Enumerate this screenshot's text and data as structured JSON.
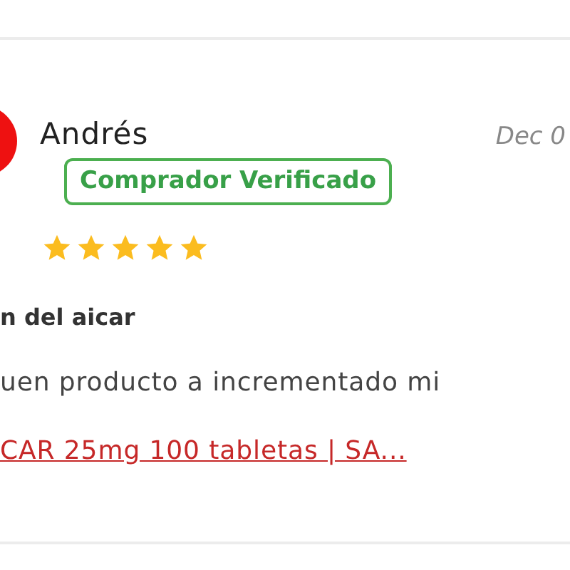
{
  "review": {
    "author": "Andrés",
    "date": "Dec 0",
    "badge": "Comprador Verificado",
    "stars": 5,
    "title": "n del aicar",
    "body": "uen producto a incrementado mi",
    "product_link": "CAR 25mg 100 tabletas | SA..."
  }
}
